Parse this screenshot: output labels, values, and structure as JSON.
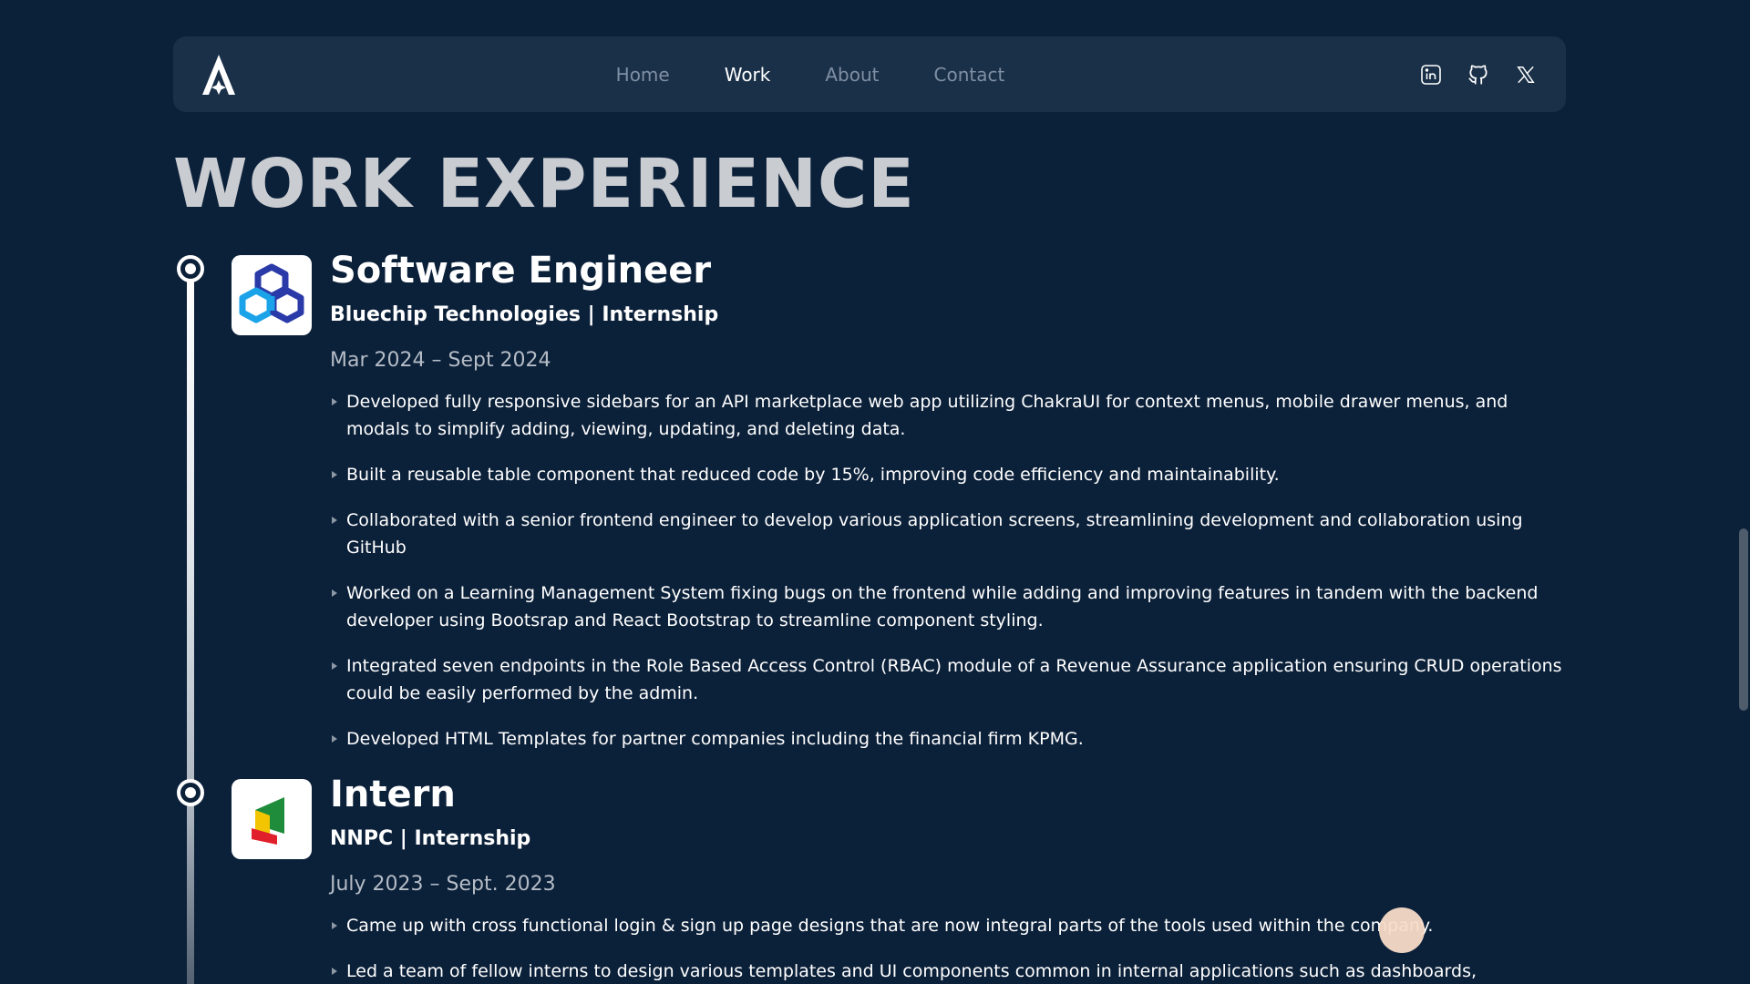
{
  "nav": {
    "links": [
      {
        "label": "Home",
        "active": false
      },
      {
        "label": "Work",
        "active": true
      },
      {
        "label": "About",
        "active": false
      },
      {
        "label": "Contact",
        "active": false
      }
    ],
    "socials": [
      "linkedin-icon",
      "github-icon",
      "x-icon"
    ]
  },
  "page": {
    "title": "WORK EXPERIENCE"
  },
  "experiences": [
    {
      "role": "Software Engineer",
      "company": "Bluechip Technologies | Internship",
      "dates": "Mar 2024 – Sept 2024",
      "bullets": [
        "Developed fully responsive sidebars for an API marketplace web app utilizing ChakraUI for context menus, mobile drawer menus, and modals to simplify adding, viewing, updating, and deleting data.",
        "Built a reusable table component that reduced code by 15%, improving code efficiency and maintainability.",
        "Collaborated with a senior frontend engineer to develop various application screens, streamlining development and collaboration using GitHub",
        "Worked on a Learning Management System fixing bugs on the frontend while adding and improving features in tandem with the backend developer using Bootsrap and React Bootstrap to streamline component styling.",
        "Integrated seven endpoints in the Role Based Access Control (RBAC) module of a Revenue Assurance application ensuring CRUD operations could be easily performed by the admin.",
        "Developed HTML Templates for partner companies including the financial firm KPMG."
      ]
    },
    {
      "role": "Intern",
      "company": "NNPC | Internship",
      "dates": "July 2023 – Sept. 2023",
      "bullets": [
        "Came up with cross functional login & sign up page designs that are now integral parts of the tools used within the company.",
        "Led a team of fellow interns to design various templates and UI components common in internal applications such as dashboards, notification"
      ]
    }
  ],
  "colors": {
    "background": "#0b2039",
    "navbar": "#1a3048",
    "nav_inactive": "#7f8fa3",
    "title": "#c9ccd1",
    "dates": "#b4bcc6"
  }
}
